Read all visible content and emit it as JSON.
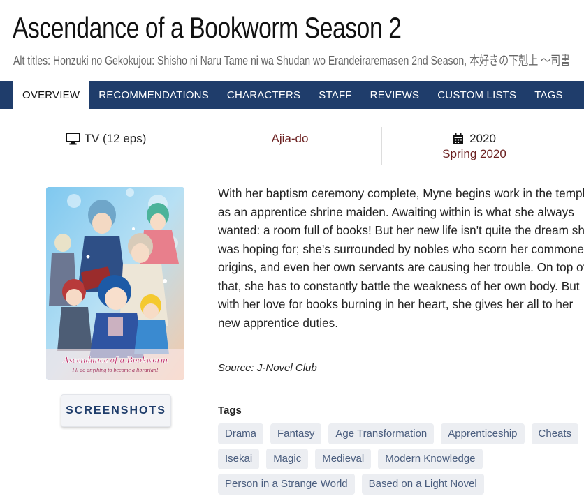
{
  "title": "Ascendance of a Bookworm Season 2",
  "alt_titles": "Alt titles: Honzuki no Gekokujou: Shisho ni Naru Tame ni wa Shudan wo Erandeiraremasen 2nd Season, 本好きの下剋上 ～司書",
  "nav": {
    "tabs": [
      {
        "label": "OVERVIEW"
      },
      {
        "label": "RECOMMENDATIONS"
      },
      {
        "label": "CHARACTERS"
      },
      {
        "label": "STAFF"
      },
      {
        "label": "REVIEWS"
      },
      {
        "label": "CUSTOM LISTS"
      },
      {
        "label": "TAGS"
      }
    ]
  },
  "info": {
    "format": "TV (12 eps)",
    "format_icon": "tv-icon",
    "studio": "Ajia-do",
    "year": "2020",
    "year_icon": "calendar-icon",
    "season": "Spring 2020"
  },
  "cover": {
    "title_line": "Ascendance of a Bookworm",
    "subtitle_line": "I'll do anything to become a librarian!"
  },
  "screenshots_label": "SCREENSHOTS",
  "synopsis": "With her baptism ceremony complete, Myne begins work in the temple as an apprentice shrine maiden. Awaiting within is what she always wanted: a room full of books! But her new life isn't quite the dream she was hoping for; she's surrounded by nobles who scorn her commoner origins, and even her own servants are causing her trouble. On top of that, she has to constantly battle the weakness of her own body. But with her love for books burning in her heart, she gives her all to her new apprentice duties.",
  "source": "Source: J-Novel Club",
  "tags_heading": "Tags",
  "tags": [
    "Drama",
    "Fantasy",
    "Age Transformation",
    "Apprenticeship",
    "Cheats",
    "Isekai",
    "Magic",
    "Medieval",
    "Modern Knowledge",
    "Person in a Strange World",
    "Based on a Light Novel"
  ],
  "colors": {
    "nav_bg": "#1f3d6b",
    "link_red": "#6b1f1f",
    "tag_bg": "#eceef2",
    "tag_text": "#4a5d7e"
  }
}
